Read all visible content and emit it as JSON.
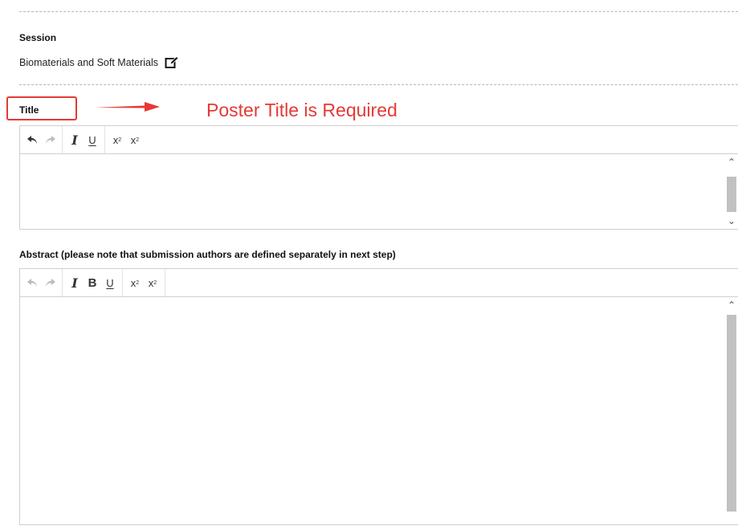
{
  "session": {
    "label": "Session",
    "value": "Biomaterials and Soft Materials",
    "edit_icon": "edit-pencil-icon"
  },
  "title_field": {
    "label": "Title",
    "toolbar": [
      "undo-icon",
      "redo-icon",
      "italic-icon",
      "underline-icon",
      "superscript-icon",
      "subscript-icon"
    ],
    "value": ""
  },
  "annotation": {
    "text": "Poster Title is Required",
    "color": "#e53935"
  },
  "abstract_field": {
    "label": "Abstract (please note that submission authors are defined separately in next step)",
    "toolbar": [
      "undo-icon",
      "redo-icon",
      "italic-icon",
      "bold-icon",
      "underline-icon",
      "superscript-icon",
      "subscript-icon"
    ],
    "value": ""
  },
  "colors": {
    "accent": "#e53935",
    "border": "#cfcfcf",
    "scroll_thumb": "#c1c1c1"
  }
}
